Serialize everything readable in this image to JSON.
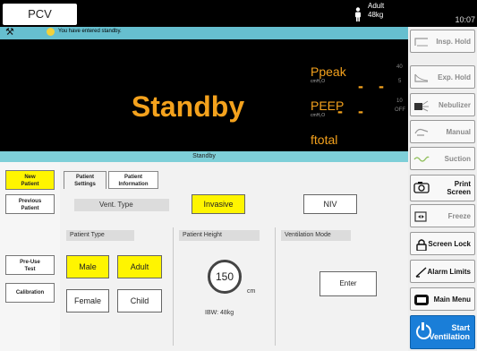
{
  "header": {
    "mode": "PCV",
    "patient_type": "Adult",
    "patient_weight": "48kg",
    "time": "10:07"
  },
  "message": {
    "text": "You have entered standby."
  },
  "status": {
    "big": "Standby",
    "banner": "Standby"
  },
  "params": [
    {
      "name": "Ppeak",
      "unit": "cmH₂O",
      "value": "- -",
      "scale_top": "40",
      "scale_bottom": "5"
    },
    {
      "name": "PEEP",
      "unit": "cmH₂O",
      "value": "- -",
      "scale_top": "10",
      "scale_bottom": "OFF"
    },
    {
      "name": "ftotal",
      "unit": "",
      "value": ""
    }
  ],
  "left_nav": {
    "new_patient": "New\nPatient",
    "previous_patient": "Previous\nPatient",
    "pre_use_test": "Pre-Use\nTest",
    "calibration": "Calibration"
  },
  "tabs": {
    "patient_settings": "Patient\nSettings",
    "patient_information": "Patient\nInformation"
  },
  "vent_type": {
    "label": "Vent. Type",
    "invasive": "Invasive",
    "niv": "NIV"
  },
  "patient_type": {
    "label": "Patient Type",
    "male": "Male",
    "adult": "Adult",
    "female": "Female",
    "child": "Child"
  },
  "patient_height": {
    "label": "Patient Height",
    "value": "150",
    "unit": "cm",
    "ibw": "IBW: 48kg"
  },
  "ventilation_mode": {
    "label": "Ventilation Mode",
    "enter": "Enter"
  },
  "right_nav": [
    {
      "label": "Insp. Hold",
      "icon": "insp-hold-icon"
    },
    {
      "label": "Exp. Hold",
      "icon": "exp-hold-icon"
    },
    {
      "label": "Nebulizer",
      "icon": "nebulizer-icon"
    },
    {
      "label": "Manual",
      "icon": "manual-icon"
    },
    {
      "label": "Suction",
      "icon": "suction-icon"
    },
    {
      "label": "Print\nScreen",
      "icon": "camera-icon"
    },
    {
      "label": "Freeze",
      "icon": "freeze-icon"
    },
    {
      "label": "Screen Lock",
      "icon": "lock-icon"
    },
    {
      "label": "Alarm Limits",
      "icon": "alarm-limits-icon"
    },
    {
      "label": "Main Menu",
      "icon": "menu-icon"
    }
  ],
  "start": {
    "label": "Start\nVentilation"
  },
  "colors": {
    "accent_orange": "#f4a21d",
    "selected_yellow": "#fff500",
    "teal_bar": "#66bfcf",
    "start_blue": "#1a7ed8"
  }
}
